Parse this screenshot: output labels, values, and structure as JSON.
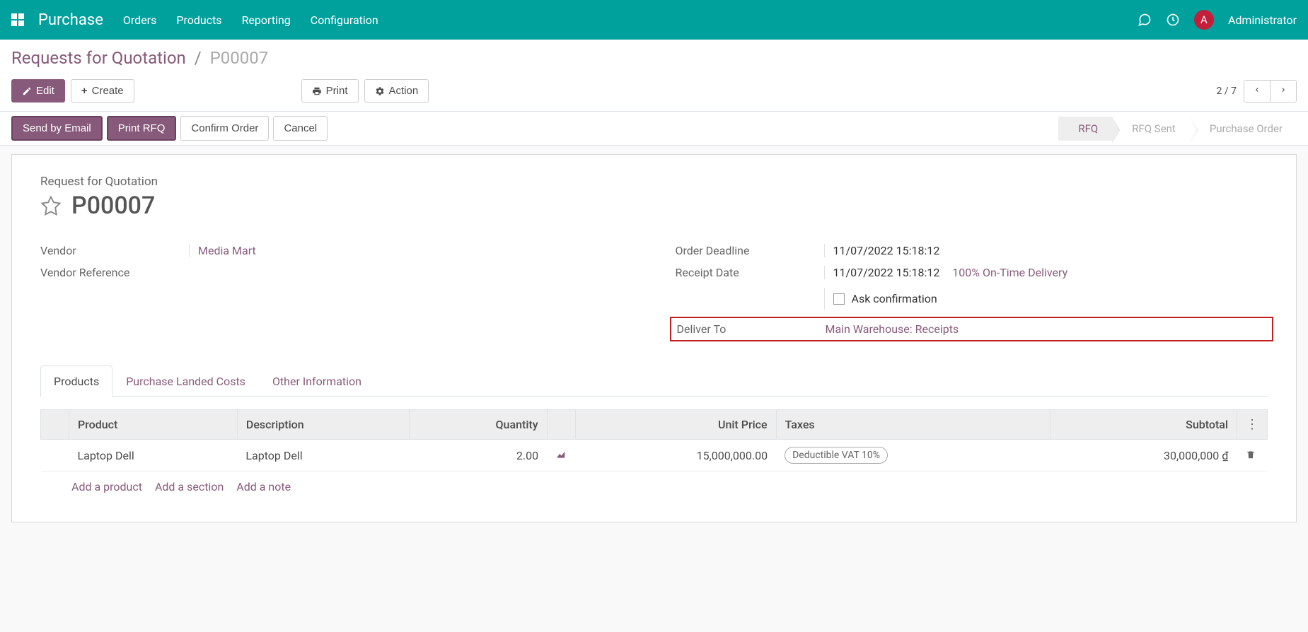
{
  "topbar": {
    "app_title": "Purchase",
    "nav": [
      "Orders",
      "Products",
      "Reporting",
      "Configuration"
    ],
    "avatar_letter": "A",
    "user_name": "Administrator"
  },
  "breadcrumb": {
    "root": "Requests for Quotation",
    "current": "P00007"
  },
  "buttons": {
    "edit": "Edit",
    "create": "Create",
    "print": "Print",
    "action": "Action",
    "send_email": "Send by Email",
    "print_rfq": "Print RFQ",
    "confirm": "Confirm Order",
    "cancel": "Cancel"
  },
  "pager": {
    "current": "2",
    "sep": "/",
    "total": "7"
  },
  "workflow": {
    "steps": [
      "RFQ",
      "RFQ Sent",
      "Purchase Order"
    ],
    "active_index": 0
  },
  "record": {
    "subtitle": "Request for Quotation",
    "name": "P00007",
    "fields": {
      "vendor_label": "Vendor",
      "vendor": "Media Mart",
      "vendor_ref_label": "Vendor Reference",
      "vendor_ref": "",
      "order_deadline_label": "Order Deadline",
      "order_deadline": "11/07/2022 15:18:12",
      "receipt_date_label": "Receipt Date",
      "receipt_date": "11/07/2022 15:18:12",
      "ontime": "100% On-Time Delivery",
      "ask_confirmation_label": "Ask confirmation",
      "deliver_to_label": "Deliver To",
      "deliver_to": "Main Warehouse: Receipts"
    }
  },
  "tabs": [
    "Products",
    "Purchase Landed Costs",
    "Other Information"
  ],
  "table": {
    "headers": {
      "product": "Product",
      "description": "Description",
      "quantity": "Quantity",
      "unit_price": "Unit Price",
      "taxes": "Taxes",
      "subtotal": "Subtotal"
    },
    "rows": [
      {
        "product": "Laptop Dell",
        "description": "Laptop Dell",
        "quantity": "2.00",
        "unit_price": "15,000,000.00",
        "taxes": "Deductible VAT 10%",
        "subtotal": "30,000,000 ₫"
      }
    ],
    "add_product": "Add a product",
    "add_section": "Add a section",
    "add_note": "Add a note"
  }
}
